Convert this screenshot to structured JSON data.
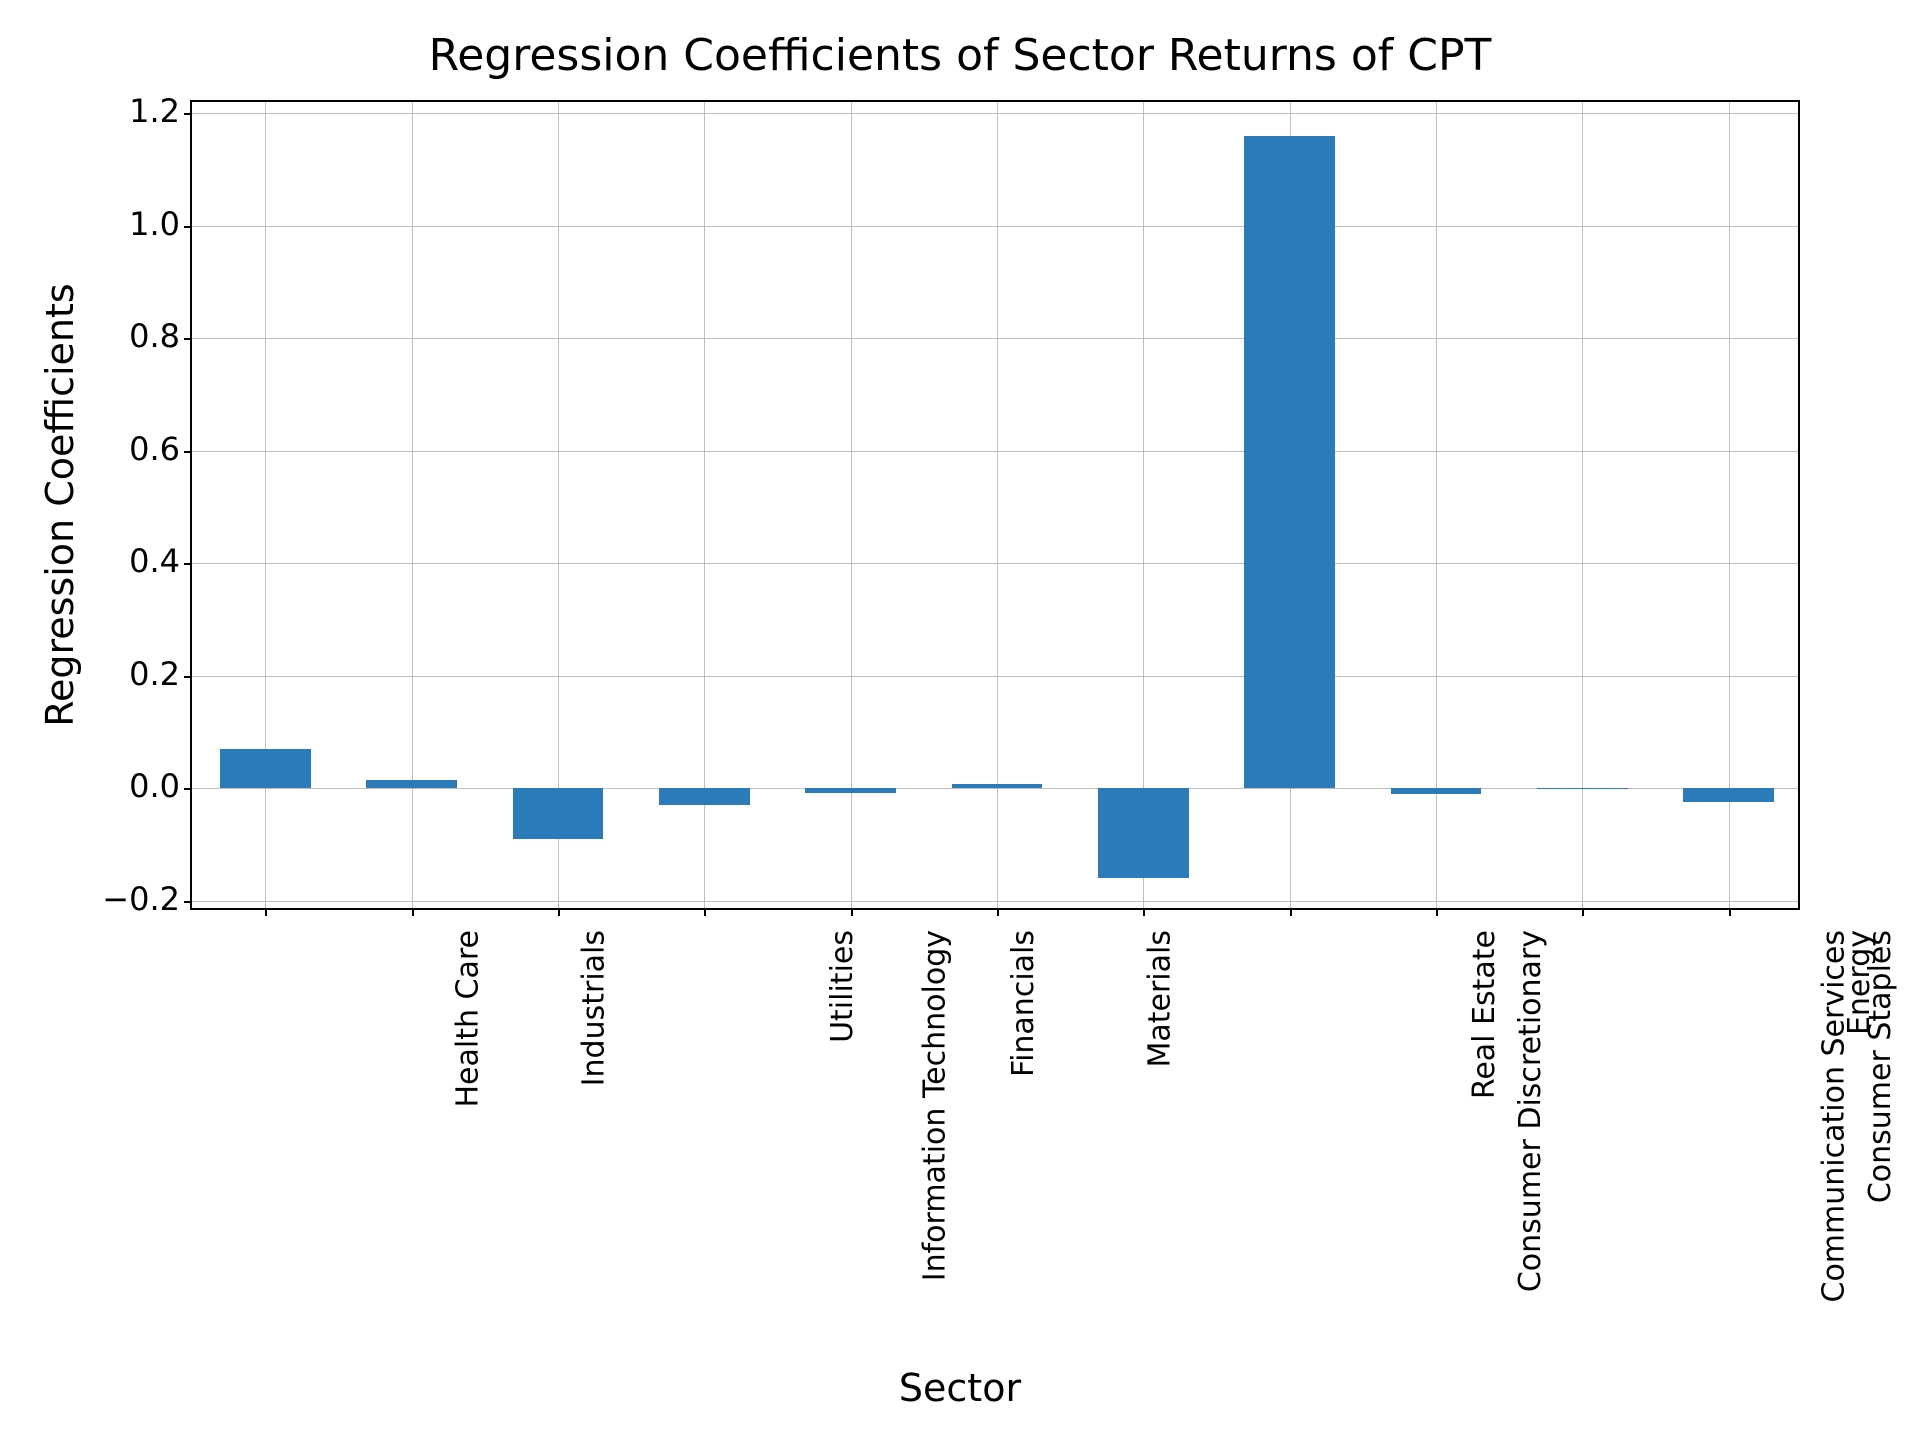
{
  "chart_data": {
    "type": "bar",
    "title": "Regression Coefficients of Sector Returns of CPT",
    "xlabel": "Sector",
    "ylabel": "Regression Coefficients",
    "ylim": [
      -0.2,
      1.2
    ],
    "yticks": [
      -0.2,
      0.0,
      0.2,
      0.4,
      0.6,
      0.8,
      1.0,
      1.2
    ],
    "ytick_labels": [
      "−0.2",
      "0.0",
      "0.2",
      "0.4",
      "0.6",
      "0.8",
      "1.0",
      "1.2"
    ],
    "categories": [
      "Health Care",
      "Industrials",
      "Information Technology",
      "Utilities",
      "Financials",
      "Materials",
      "Consumer Discretionary",
      "Real Estate",
      "Communication Services",
      "Consumer Staples",
      "Energy"
    ],
    "values": [
      0.07,
      0.015,
      -0.09,
      -0.03,
      -0.008,
      0.008,
      -0.16,
      1.16,
      -0.01,
      0.0,
      -0.025
    ],
    "bar_color": "#2b7bba"
  }
}
